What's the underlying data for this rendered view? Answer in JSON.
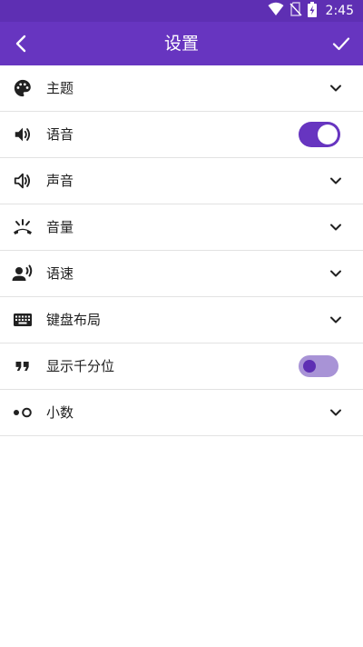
{
  "status_bar": {
    "time": "2:45",
    "icons": [
      "wifi-icon",
      "no-sim-icon",
      "battery-charging-icon"
    ]
  },
  "app_bar": {
    "title": "设置",
    "back_icon": "back-arrow-icon",
    "confirm_icon": "check-icon",
    "color": "#6735c0"
  },
  "settings": [
    {
      "label": "主题",
      "icon": "palette-icon",
      "control": "dropdown"
    },
    {
      "label": "语音",
      "icon": "volume-icon",
      "control": "toggle",
      "checked": true
    },
    {
      "label": "声音",
      "icon": "volume-low-icon",
      "control": "dropdown"
    },
    {
      "label": "音量",
      "icon": "ringer-volume-icon",
      "control": "dropdown"
    },
    {
      "label": "语速",
      "icon": "record-voice-icon",
      "control": "dropdown"
    },
    {
      "label": "键盘布局",
      "icon": "keyboard-icon",
      "control": "dropdown"
    },
    {
      "label": "显示千分位",
      "icon": "format-quote-icon",
      "control": "toggle",
      "checked": false
    },
    {
      "label": "小数",
      "icon": "decimal-icon",
      "control": "dropdown"
    }
  ],
  "colors": {
    "accent": "#6735c0",
    "status_bar": "#5e2fb3",
    "toggle_off_track": "#a893d6",
    "divider": "#e2e2e2"
  }
}
